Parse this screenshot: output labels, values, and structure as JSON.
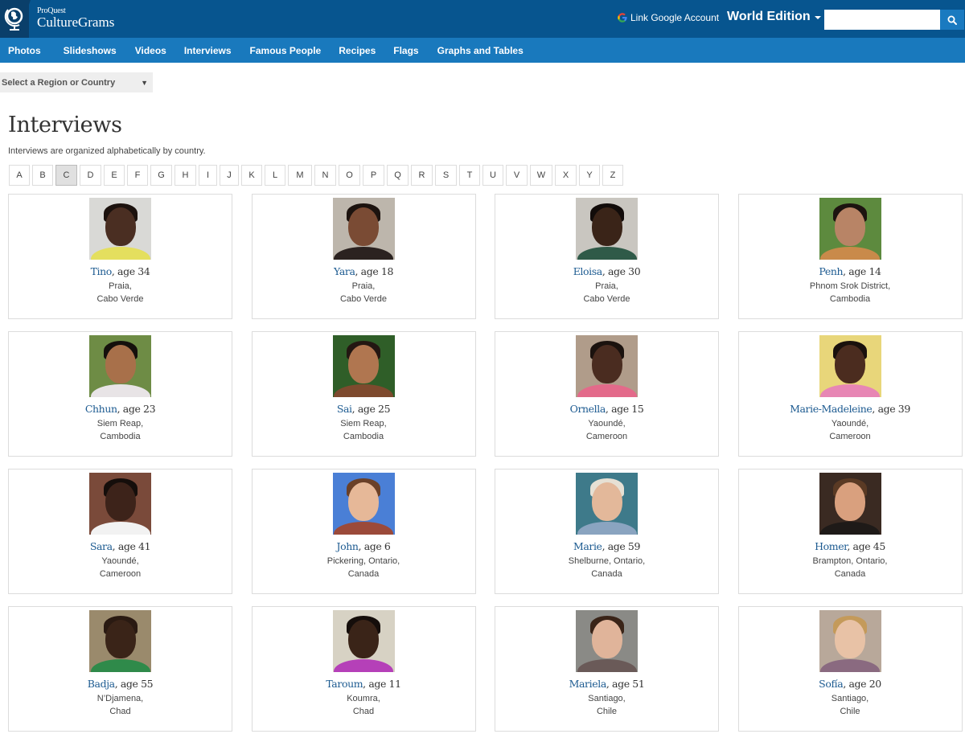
{
  "header": {
    "brand_small": "ProQuest",
    "brand_large": "CultureGrams",
    "google_link": "Link Google Account",
    "edition": "World Edition",
    "search": {
      "value": "",
      "placeholder": ""
    }
  },
  "nav": {
    "items": [
      {
        "label": "Photos"
      },
      {
        "label": "Slideshows"
      },
      {
        "label": "Videos"
      },
      {
        "label": "Interviews"
      },
      {
        "label": "Famous People"
      },
      {
        "label": "Recipes"
      },
      {
        "label": "Flags"
      },
      {
        "label": "Graphs and Tables"
      }
    ]
  },
  "region_select": {
    "selected": "Select a Region or Country"
  },
  "page": {
    "title": "Interviews",
    "subtitle": "Interviews are organized alphabetically by country."
  },
  "alphabet": {
    "letters": [
      "A",
      "B",
      "C",
      "D",
      "E",
      "F",
      "G",
      "H",
      "I",
      "J",
      "K",
      "L",
      "M",
      "N",
      "O",
      "P",
      "Q",
      "R",
      "S",
      "T",
      "U",
      "V",
      "W",
      "X",
      "Y",
      "Z"
    ],
    "active": "C"
  },
  "interviews": [
    {
      "name": "Tino",
      "age_text": ", age 34",
      "city": "Praia,",
      "country": "Cabo Verde",
      "colors": {
        "bg": "#d9d9d6",
        "skin": "#4a2e22",
        "hair": "#1c120e",
        "shirt": "#e4df5e"
      }
    },
    {
      "name": "Yara",
      "age_text": ", age 18",
      "city": "Praia,",
      "country": "Cabo Verde",
      "colors": {
        "bg": "#bdb6ac",
        "skin": "#7a4b34",
        "hair": "#1c130f",
        "shirt": "#2b2220"
      }
    },
    {
      "name": "Eloisa",
      "age_text": ", age 30",
      "city": "Praia,",
      "country": "Cabo Verde",
      "colors": {
        "bg": "#c9c6c0",
        "skin": "#3a2418",
        "hair": "#120c0a",
        "shirt": "#2f5a48"
      }
    },
    {
      "name": "Penh",
      "age_text": ", age 14",
      "city": "Phnom Srok District,",
      "country": "Cambodia",
      "colors": {
        "bg": "#5d8a3e",
        "skin": "#b88466",
        "hair": "#1d1410",
        "shirt": "#c98a4a"
      }
    },
    {
      "name": "Chhun",
      "age_text": ", age 23",
      "city": "Siem Reap,",
      "country": "Cambodia",
      "colors": {
        "bg": "#6e8c45",
        "skin": "#a8704a",
        "hair": "#15100c",
        "shirt": "#e8e4e6"
      }
    },
    {
      "name": "Sai",
      "age_text": ", age 25",
      "city": "Siem Reap,",
      "country": "Cambodia",
      "colors": {
        "bg": "#2f5e28",
        "skin": "#b07650",
        "hair": "#231712",
        "shirt": "#7e4a2e"
      }
    },
    {
      "name": "Ornella",
      "age_text": ", age 15",
      "city": "Yaoundé,",
      "country": "Cameroon",
      "colors": {
        "bg": "#b09c8a",
        "skin": "#4a2c20",
        "hair": "#1b120e",
        "shirt": "#e36a8a"
      }
    },
    {
      "name": "Marie-Madeleine",
      "age_text": ", age 39",
      "city": "Yaoundé,",
      "country": "Cameroon",
      "colors": {
        "bg": "#e8d67a",
        "skin": "#4b2c1f",
        "hair": "#1a110d",
        "shirt": "#e786b4"
      }
    },
    {
      "name": "Sara",
      "age_text": ", age 41",
      "city": "Yaoundé,",
      "country": "Cameroon",
      "colors": {
        "bg": "#7a4a3a",
        "skin": "#3d231a",
        "hair": "#150e0b",
        "shirt": "#f2f2f2"
      }
    },
    {
      "name": "John",
      "age_text": ", age 6",
      "city": "Pickering, Ontario,",
      "country": "Canada",
      "colors": {
        "bg": "#4a7fd6",
        "skin": "#e6b898",
        "hair": "#6a4028",
        "shirt": "#9b4a3a"
      }
    },
    {
      "name": "Marie",
      "age_text": ", age 59",
      "city": "Shelburne, Ontario,",
      "country": "Canada",
      "colors": {
        "bg": "#3e7a8a",
        "skin": "#e3b89a",
        "hair": "#e6e0d4",
        "shirt": "#8aa4c0"
      }
    },
    {
      "name": "Homer",
      "age_text": ", age 45",
      "city": "Brampton, Ontario,",
      "country": "Canada",
      "colors": {
        "bg": "#3a2a22",
        "skin": "#d9a07e",
        "hair": "#5a3a24",
        "shirt": "#1e1a18"
      }
    },
    {
      "name": "Badja",
      "age_text": ", age 55",
      "city": "N’Djamena,",
      "country": "Chad",
      "colors": {
        "bg": "#9a8a6c",
        "skin": "#3a2418",
        "hair": "#2a1a12",
        "shirt": "#2f8a4a"
      }
    },
    {
      "name": "Taroum",
      "age_text": ", age 11",
      "city": "Koumra,",
      "country": "Chad",
      "colors": {
        "bg": "#d7d2c4",
        "skin": "#3a2418",
        "hair": "#150e0b",
        "shirt": "#b540b8"
      }
    },
    {
      "name": "Mariela",
      "age_text": ", age 51",
      "city": "Santiago,",
      "country": "Chile",
      "colors": {
        "bg": "#8a8a86",
        "skin": "#e0b49a",
        "hair": "#3a2418",
        "shirt": "#6a5a58"
      }
    },
    {
      "name": "Sofía",
      "age_text": ", age 20",
      "city": "Santiago,",
      "country": "Chile",
      "colors": {
        "bg": "#b8a89a",
        "skin": "#e8c2a6",
        "hair": "#c49a5a",
        "shirt": "#8a6a80"
      }
    }
  ]
}
